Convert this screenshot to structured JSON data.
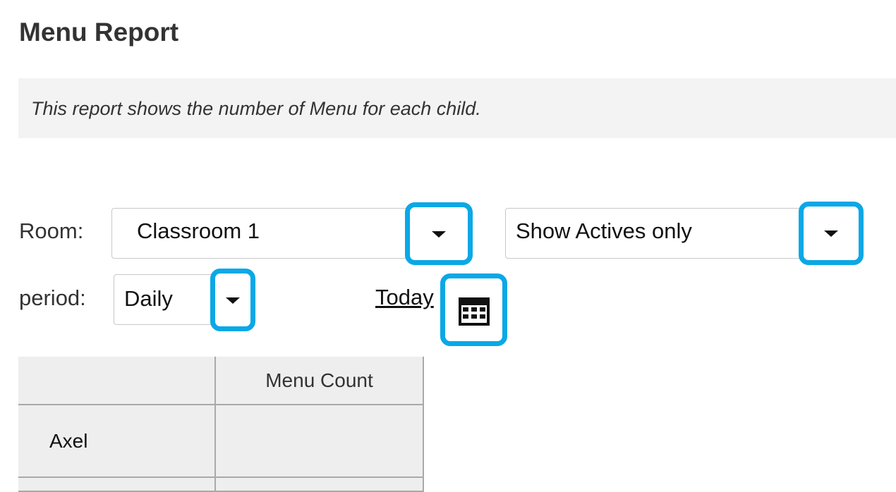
{
  "page": {
    "title": "Menu Report",
    "description": "This report shows the number of Menu for each child."
  },
  "filters": {
    "room": {
      "label": "Room:",
      "selected": "Classroom 1",
      "dropdown_icon": "caret-down-icon"
    },
    "status": {
      "selected": "Show Actives only",
      "dropdown_icon": "caret-down-icon"
    },
    "period": {
      "label": "period:",
      "selected": "Daily",
      "dropdown_icon": "caret-down-icon"
    },
    "date": {
      "link_label": "Today",
      "icon": "calendar-icon"
    }
  },
  "table": {
    "columns": [
      "",
      "Menu Count"
    ],
    "rows": [
      {
        "name": "Axel",
        "menu_count": ""
      },
      {
        "name": "",
        "menu_count": ""
      }
    ]
  },
  "colors": {
    "highlight": "#0aa8e6",
    "description_background": "#f3f3f3",
    "table_background": "#eeeeee"
  }
}
